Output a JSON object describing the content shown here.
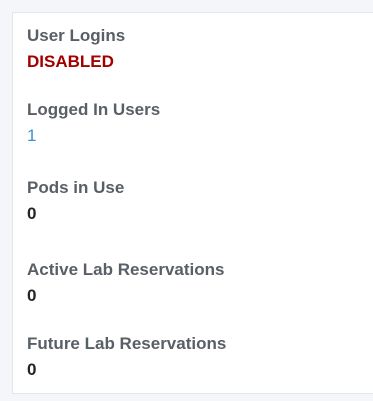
{
  "stats": [
    {
      "label": "User Logins",
      "value": "DISABLED"
    },
    {
      "label": "Logged In Users",
      "value": "1"
    },
    {
      "label": "Pods in Use",
      "value": "0"
    },
    {
      "label": "Active Lab Reservations",
      "value": "0"
    },
    {
      "label": "Future Lab Reservations",
      "value": "0"
    }
  ],
  "colors": {
    "disabled": "#a00000",
    "link": "#3e8ed0",
    "label": "#595f66",
    "value": "#212529"
  }
}
